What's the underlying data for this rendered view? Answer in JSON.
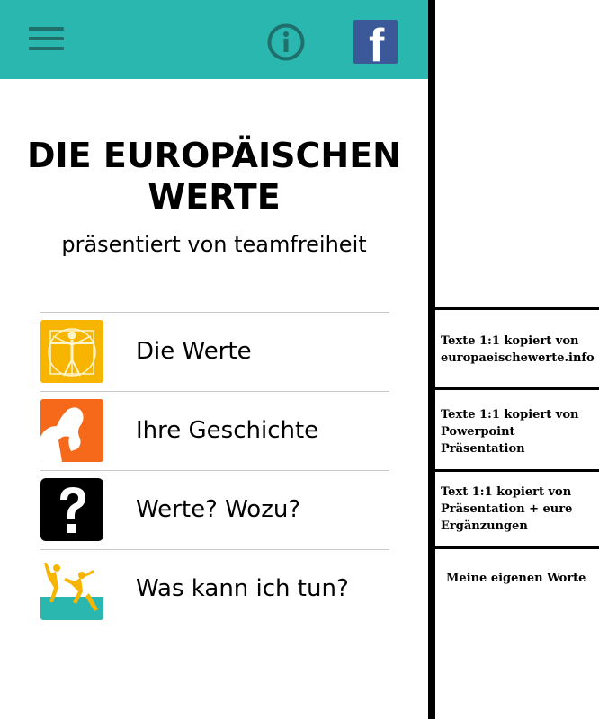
{
  "header": {
    "menu_icon": "hamburger-menu-icon",
    "info_icon": "info-icon",
    "facebook_icon": "facebook-icon",
    "facebook_glyph": "f",
    "accent_color": "#2ab7b0",
    "facebook_color": "#3b5998"
  },
  "main": {
    "title": "DIE EUROPÄISCHEN WERTE",
    "subtitle": "präsentiert von teamfreiheit"
  },
  "menu": {
    "items": [
      {
        "label": "Die Werte",
        "icon": "vitruvian-man-icon",
        "icon_color": "#f7b500"
      },
      {
        "label": "Ihre Geschichte",
        "icon": "thinker-icon",
        "icon_color": "#f7691a"
      },
      {
        "label": "Werte? Wozu?",
        "icon": "question-mark-icon",
        "icon_color": "#000000"
      },
      {
        "label": "Was kann ich tun?",
        "icon": "jumping-people-icon",
        "icon_color": "#2ab7b0"
      }
    ]
  },
  "notes": {
    "items": [
      {
        "text": "Texte 1:1 kopiert von europaeischewerte.info"
      },
      {
        "text": "Texte 1:1 kopiert von Powerpoint Präsentation"
      },
      {
        "text": "Text 1:1 kopiert von Präsentation + eure Ergänzungen"
      },
      {
        "text": "Meine eigenen Worte"
      }
    ]
  }
}
